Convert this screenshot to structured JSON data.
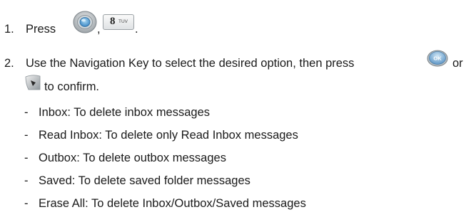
{
  "steps": [
    {
      "number": "1.",
      "text_before": "Press",
      "separator": ",",
      "end": ".",
      "icons": [
        "menu-key-icon",
        "8-tuv-key-icon"
      ],
      "key_label_main": "8",
      "key_label_sub": "TUV"
    },
    {
      "number": "2.",
      "text_before": "Use the Navigation Key to select the desired option, then press",
      "text_or": "or",
      "text_confirm": "to confirm.",
      "icons": [
        "ok-key-icon",
        "softkey-icon"
      ]
    }
  ],
  "options": [
    {
      "dash": "-",
      "text": "Inbox: To delete inbox messages"
    },
    {
      "dash": "-",
      "text": "Read Inbox: To delete only Read Inbox messages"
    },
    {
      "dash": "-",
      "text": "Outbox: To delete outbox messages"
    },
    {
      "dash": "-",
      "text": "Saved: To delete saved folder messages"
    },
    {
      "dash": "-",
      "text": "Erase All: To delete Inbox/Outbox/Saved messages"
    }
  ]
}
